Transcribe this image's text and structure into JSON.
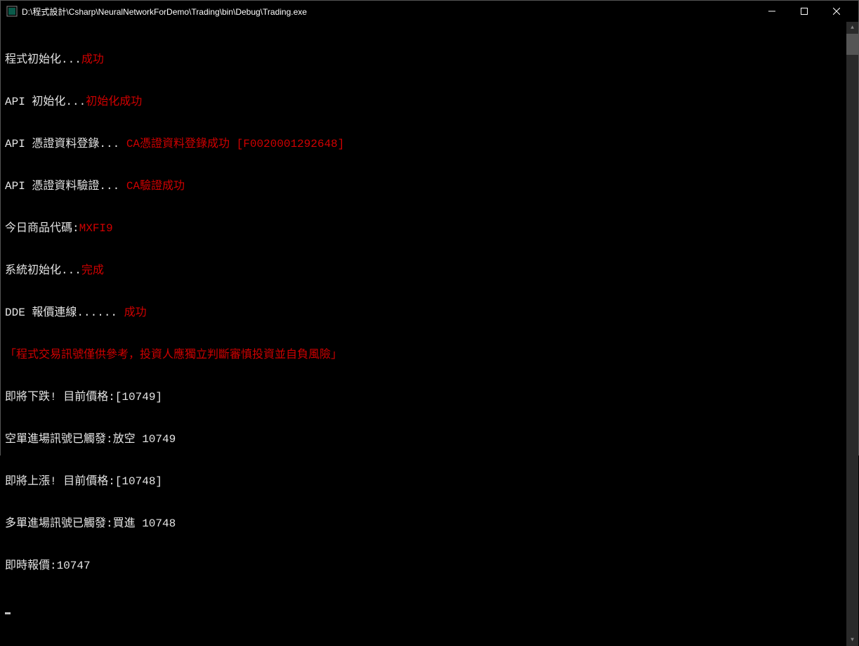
{
  "titlebar": {
    "title": "D:\\程式設計\\Csharp\\NeuralNetworkForDemo\\Trading\\bin\\Debug\\Trading.exe"
  },
  "lines": [
    {
      "white": "程式初始化...",
      "red": "成功"
    },
    {
      "white": "API 初始化...",
      "red": "初始化成功"
    },
    {
      "white": "API 憑證資料登錄... ",
      "red": "CA憑證資料登錄成功 [F0020001292648]"
    },
    {
      "white": "API 憑證資料驗證... ",
      "red": "CA驗證成功"
    },
    {
      "white": "今日商品代碼:",
      "red": "MXFI9"
    },
    {
      "white": "系統初始化...",
      "red": "完成"
    },
    {
      "white": "DDE 報價連線...... ",
      "red": "成功"
    },
    {
      "white": "",
      "red": "「程式交易訊號僅供參考，投資人應獨立判斷審慎投資並自負風險」"
    },
    {
      "white": "即將下跌! 目前價格:[10749]",
      "red": ""
    },
    {
      "white": "空單進場訊號已觸發:放空 10749",
      "red": ""
    },
    {
      "white": "即將上漲! 目前價格:[10748]",
      "red": ""
    },
    {
      "white": "多單進場訊號已觸發:買進 10748",
      "red": ""
    },
    {
      "white": "即時報價:10747",
      "red": ""
    }
  ]
}
